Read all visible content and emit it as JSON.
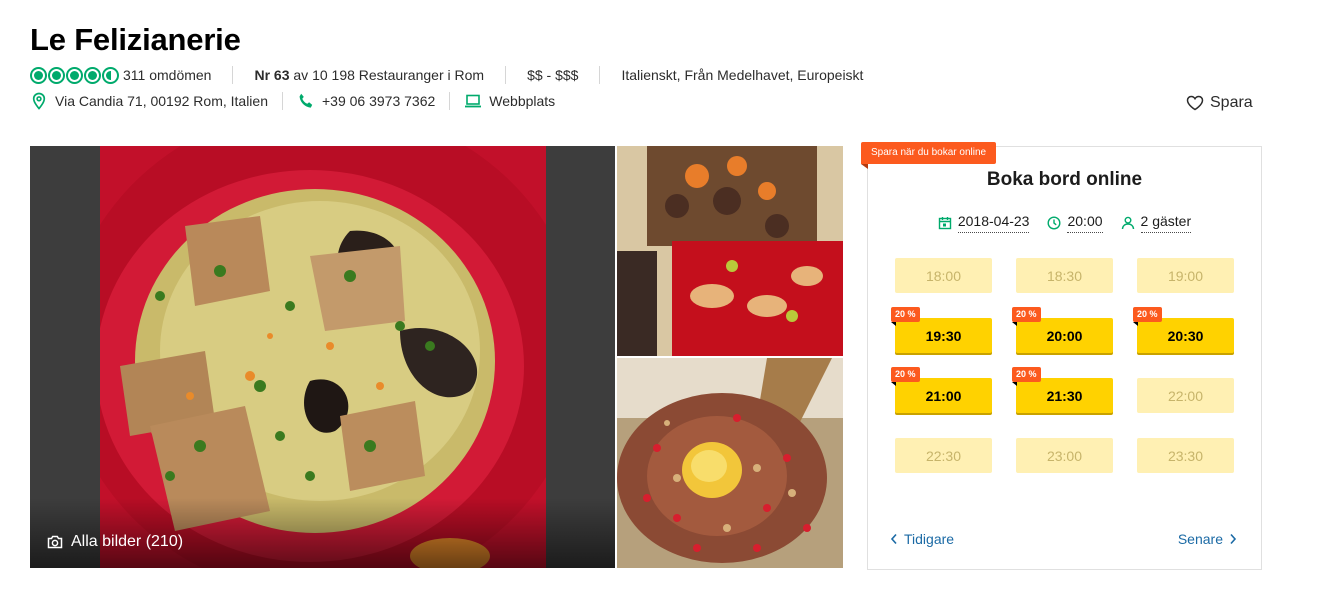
{
  "restaurant": {
    "name": "Le Felizianerie",
    "rating_bubbles": 4.5,
    "reviews": "311 omdömen",
    "rank_bold": "Nr 63",
    "rank_rest": "av 10 198 Restauranger i Rom",
    "price": "$$ - $$$",
    "cuisines": "Italienskt, Från Medelhavet, Europeiskt",
    "address": "Via Candia 71, 00192 Rom, Italien",
    "phone": "+39 06 3973 7362",
    "website": "Webbplats",
    "save_label": "Spara"
  },
  "gallery": {
    "all_photos_label": "Alla bilder (210)"
  },
  "booking": {
    "promo": "Spara när du bokar online",
    "title": "Boka bord online",
    "date": "2018-04-23",
    "time": "20:00",
    "guests": "2 gäster",
    "slots": [
      {
        "time": "18:00",
        "available": false,
        "discount": ""
      },
      {
        "time": "18:30",
        "available": false,
        "discount": ""
      },
      {
        "time": "19:00",
        "available": false,
        "discount": ""
      },
      {
        "time": "19:30",
        "available": true,
        "discount": "20 %"
      },
      {
        "time": "20:00",
        "available": true,
        "discount": "20 %"
      },
      {
        "time": "20:30",
        "available": true,
        "discount": "20 %"
      },
      {
        "time": "21:00",
        "available": true,
        "discount": "20 %"
      },
      {
        "time": "21:30",
        "available": true,
        "discount": "20 %"
      },
      {
        "time": "22:00",
        "available": false,
        "discount": ""
      },
      {
        "time": "22:30",
        "available": false,
        "discount": ""
      },
      {
        "time": "23:00",
        "available": false,
        "discount": ""
      },
      {
        "time": "23:30",
        "available": false,
        "discount": ""
      }
    ],
    "prev_label": "Tidigare",
    "next_label": "Senare"
  },
  "colors": {
    "accent_green": "#00aa6c",
    "slot_yellow": "#ffd200",
    "promo_orange": "#fc5a1e",
    "link_blue": "#1b6aa5"
  }
}
